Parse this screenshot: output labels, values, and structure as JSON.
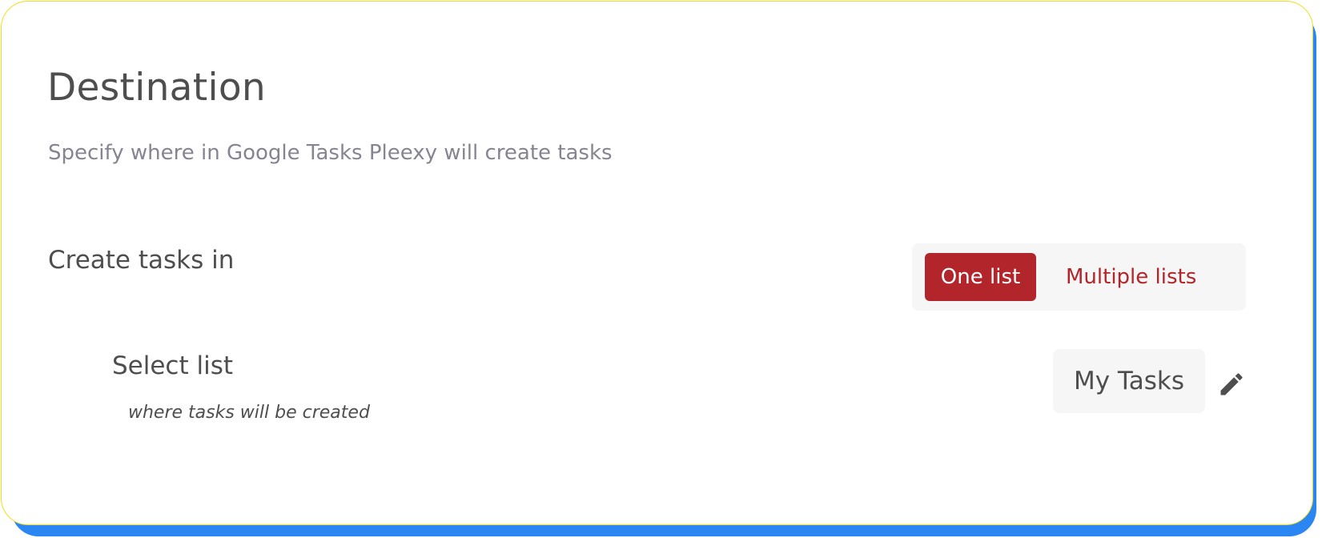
{
  "destination": {
    "title": "Destination",
    "subtitle": "Specify where in Google Tasks Pleexy will create tasks"
  },
  "create_tasks": {
    "label": "Create tasks in",
    "options": [
      "One list",
      "Multiple lists"
    ],
    "selected": "One list"
  },
  "select_list": {
    "label": "Select list",
    "hint": "where tasks will be created",
    "value": "My Tasks"
  },
  "colors": {
    "accent": "#b2262b",
    "shadow": "#2a86f3",
    "border": "#f0dd18"
  },
  "icons": {
    "edit": "pencil-icon"
  }
}
